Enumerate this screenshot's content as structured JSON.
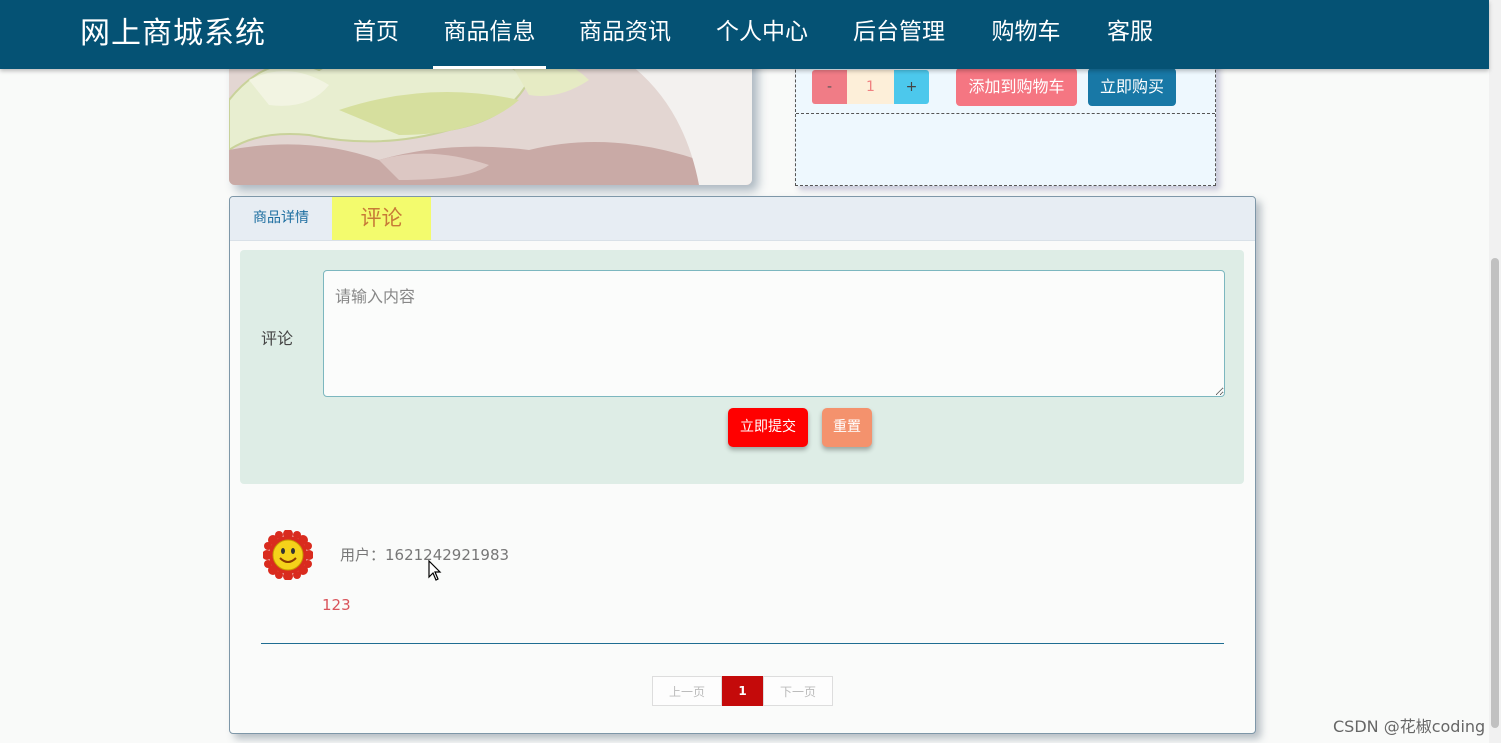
{
  "nav": {
    "brand": "网上商城系统",
    "items": [
      {
        "label": "首页"
      },
      {
        "label": "商品信息",
        "active": true
      },
      {
        "label": "商品资讯"
      },
      {
        "label": "个人中心"
      },
      {
        "label": "后台管理"
      },
      {
        "label": "购物车"
      },
      {
        "label": "客服"
      }
    ]
  },
  "purchase": {
    "minus_label": "-",
    "quantity": "1",
    "plus_label": "+",
    "add_to_cart_label": "添加到购物车",
    "buy_now_label": "立即购买"
  },
  "tabs": {
    "detail_label": "商品详情",
    "comment_label": "评论",
    "active": "评论"
  },
  "comment_form": {
    "label": "评论",
    "placeholder": "请输入内容",
    "value": "",
    "submit_label": "立即提交",
    "reset_label": "重置"
  },
  "comments": [
    {
      "user": "用户：1621242921983",
      "text": "123"
    }
  ],
  "pagination": {
    "prev_label": "上一页",
    "current_page": "1",
    "next_label": "下一页"
  },
  "watermark": "CSDN @花椒coding",
  "colors": {
    "nav_bg": "#055274",
    "active_tab_bg": "#f3fb6d",
    "submit_bg": "#ff0000",
    "reset_bg": "#f4926d",
    "cart_bg": "#f57682",
    "buy_bg": "#1878a6",
    "page_current_bg": "#c40a0a"
  }
}
